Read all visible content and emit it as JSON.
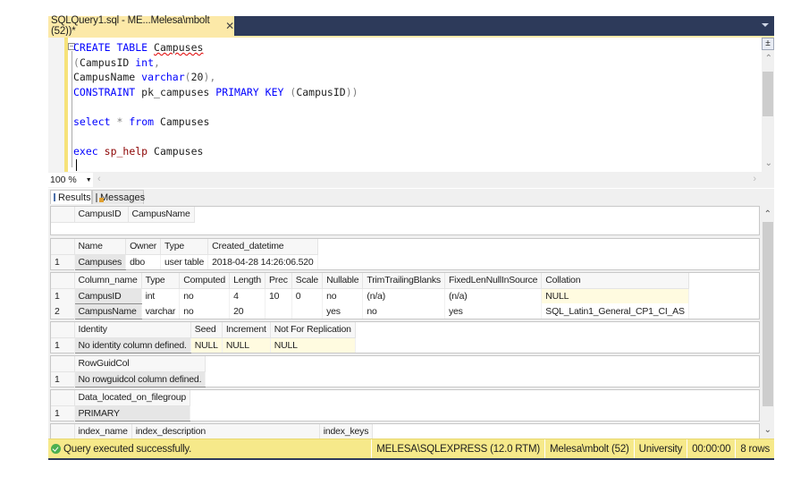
{
  "tab": {
    "title": "SQLQuery1.sql - ME...Melesa\\mbolt (52))*",
    "close": "✕"
  },
  "editor": {
    "lines": [
      {
        "parts": [
          [
            "kw",
            "CREATE TABLE"
          ],
          [
            "txt",
            " "
          ],
          [
            "squig",
            "Campuses"
          ]
        ]
      },
      {
        "parts": [
          [
            "gray",
            "("
          ],
          [
            "txt",
            "CampusID "
          ],
          [
            "kw",
            "int"
          ],
          [
            "gray",
            ","
          ]
        ]
      },
      {
        "parts": [
          [
            "txt",
            "CampusName "
          ],
          [
            "kw",
            "varchar"
          ],
          [
            "gray",
            "("
          ],
          [
            "txt",
            "20"
          ],
          [
            "gray",
            "),"
          ]
        ]
      },
      {
        "parts": [
          [
            "kw",
            "CONSTRAINT"
          ],
          [
            "txt",
            " pk_campuses "
          ],
          [
            "kw",
            "PRIMARY KEY"
          ],
          [
            "txt",
            " "
          ],
          [
            "gray",
            "("
          ],
          [
            "txt",
            "CampusID"
          ],
          [
            "gray",
            "))"
          ]
        ]
      },
      {
        "parts": []
      },
      {
        "parts": [
          [
            "kw",
            "select"
          ],
          [
            "txt",
            " "
          ],
          [
            "gray",
            "*"
          ],
          [
            "txt",
            " "
          ],
          [
            "kw",
            "from"
          ],
          [
            "txt",
            " Campuses"
          ]
        ]
      },
      {
        "parts": []
      },
      {
        "parts": [
          [
            "kw",
            "exec"
          ],
          [
            "txt",
            " "
          ],
          [
            "fn",
            "sp_help"
          ],
          [
            "txt",
            " Campuses"
          ]
        ]
      }
    ]
  },
  "zoom": {
    "value": "100 %"
  },
  "result_tabs": {
    "results": "Results",
    "messages": "Messages"
  },
  "results": {
    "grid1": {
      "headers": [
        "CampusID",
        "CampusName"
      ],
      "rows": []
    },
    "grid2": {
      "headers": [
        "Name",
        "Owner",
        "Type",
        "Created_datetime"
      ],
      "rows": [
        [
          "1",
          "Campuses",
          "dbo",
          "user table",
          "2018-04-28 14:26:06.520"
        ]
      ]
    },
    "grid3": {
      "headers": [
        "Column_name",
        "Type",
        "Computed",
        "Length",
        "Prec",
        "Scale",
        "Nullable",
        "TrimTrailingBlanks",
        "FixedLenNullInSource",
        "Collation"
      ],
      "rows": [
        [
          "1",
          "CampusID",
          "int",
          "no",
          "4",
          "10",
          "0",
          "no",
          "(n/a)",
          "(n/a)",
          "NULL"
        ],
        [
          "2",
          "CampusName",
          "varchar",
          "no",
          "20",
          "",
          "",
          "yes",
          "no",
          "yes",
          "SQL_Latin1_General_CP1_CI_AS"
        ]
      ]
    },
    "grid4": {
      "headers": [
        "Identity",
        "Seed",
        "Increment",
        "Not For Replication"
      ],
      "rows": [
        [
          "1",
          "No identity column defined.",
          "NULL",
          "NULL",
          "NULL"
        ]
      ]
    },
    "grid5": {
      "headers": [
        "RowGuidCol"
      ],
      "rows": [
        [
          "1",
          "No rowguidcol column defined."
        ]
      ]
    },
    "grid6": {
      "headers": [
        "Data_located_on_filegroup"
      ],
      "rows": [
        [
          "1",
          "PRIMARY"
        ]
      ]
    },
    "grid7": {
      "headers": [
        "index_name",
        "index_description",
        "index_keys"
      ],
      "rows": []
    }
  },
  "status": {
    "message": "Query executed successfully.",
    "server": "MELESA\\SQLEXPRESS (12.0 RTM)",
    "user": "Melesa\\mbolt (52)",
    "database": "University",
    "elapsed": "00:00:00",
    "rows": "8 rows"
  }
}
